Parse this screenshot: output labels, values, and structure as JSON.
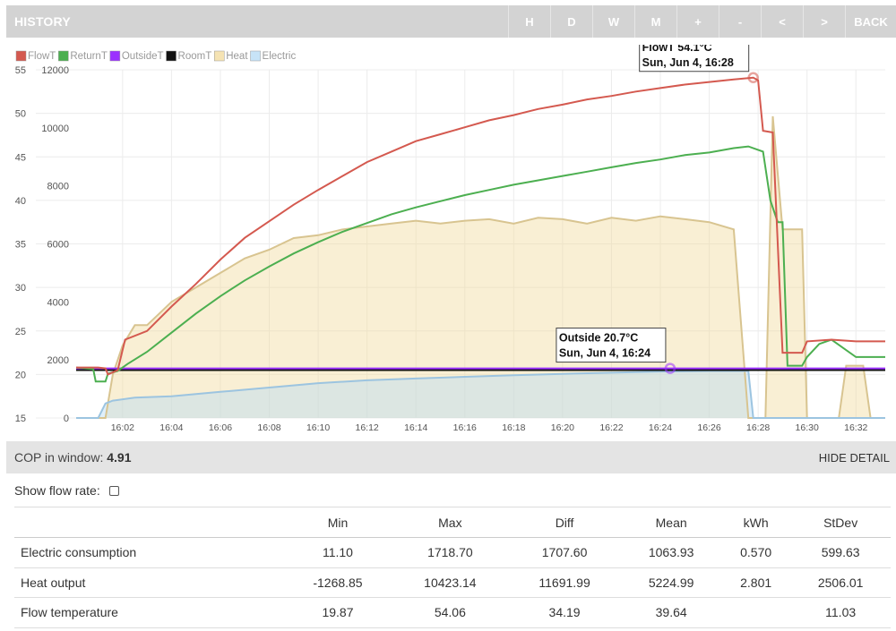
{
  "header": {
    "title": "HISTORY",
    "buttons": [
      "H",
      "D",
      "W",
      "M",
      "+",
      "-",
      "<",
      ">",
      "BACK"
    ]
  },
  "colors": {
    "FlowT": "#d4594f",
    "ReturnT": "#4caf50",
    "OutsideT": "#9b30ff",
    "RoomT": "#111111",
    "Heat": "#f2dca0",
    "Electric": "#b9dcf5"
  },
  "chart_data": {
    "type": "line",
    "legend": [
      "FlowT",
      "ReturnT",
      "OutsideT",
      "RoomT",
      "Heat",
      "Electric"
    ],
    "legend_position": "top-left",
    "y_left": {
      "ticks": [
        "55",
        "50",
        "45",
        "40",
        "35",
        "30",
        "25",
        "20",
        "15"
      ],
      "ylim": [
        15,
        55
      ],
      "unit": "°C"
    },
    "y_right": {
      "ticks": [
        "12000",
        "10000",
        "8000",
        "6000",
        "4000",
        "2000",
        "0"
      ],
      "ylim": [
        0,
        12000
      ],
      "unit": "W"
    },
    "x_ticks": [
      "16:02",
      "16:04",
      "16:06",
      "16:08",
      "16:10",
      "16:12",
      "16:14",
      "16:16",
      "16:18",
      "16:20",
      "16:22",
      "16:24",
      "16:26",
      "16:28",
      "16:30",
      "16:32"
    ],
    "x_range_minutes": [
      0.1,
      33.2
    ],
    "grid": true,
    "series": [
      {
        "name": "FlowT",
        "axis": "left",
        "points": [
          [
            0.1,
            20.8
          ],
          [
            1.0,
            20.8
          ],
          [
            1.3,
            20.7
          ],
          [
            1.4,
            20.0
          ],
          [
            1.8,
            20.5
          ],
          [
            2.1,
            24.0
          ],
          [
            3.0,
            25.0
          ],
          [
            4.0,
            27.8
          ],
          [
            5.0,
            30.4
          ],
          [
            6.0,
            33.2
          ],
          [
            7.0,
            35.7
          ],
          [
            8.0,
            37.6
          ],
          [
            9.0,
            39.5
          ],
          [
            10.0,
            41.2
          ],
          [
            11.0,
            42.8
          ],
          [
            12.0,
            44.4
          ],
          [
            13.0,
            45.6
          ],
          [
            14.0,
            46.8
          ],
          [
            15.0,
            47.6
          ],
          [
            16.0,
            48.4
          ],
          [
            17.0,
            49.2
          ],
          [
            18.0,
            49.8
          ],
          [
            19.0,
            50.5
          ],
          [
            20.0,
            51.0
          ],
          [
            21.0,
            51.6
          ],
          [
            22.0,
            52.0
          ],
          [
            23.0,
            52.5
          ],
          [
            24.0,
            52.9
          ],
          [
            25.0,
            53.3
          ],
          [
            26.0,
            53.6
          ],
          [
            27.0,
            53.9
          ],
          [
            27.8,
            54.1
          ],
          [
            28.0,
            53.8
          ],
          [
            28.2,
            48.0
          ],
          [
            28.6,
            47.8
          ],
          [
            29.0,
            22.5
          ],
          [
            29.8,
            22.5
          ],
          [
            30.0,
            23.8
          ],
          [
            31.0,
            24.0
          ],
          [
            32.0,
            23.8
          ],
          [
            33.2,
            23.8
          ]
        ]
      },
      {
        "name": "ReturnT",
        "axis": "left",
        "points": [
          [
            0.1,
            20.8
          ],
          [
            0.8,
            20.6
          ],
          [
            0.9,
            19.2
          ],
          [
            1.3,
            19.2
          ],
          [
            1.4,
            20.1
          ],
          [
            1.8,
            20.4
          ],
          [
            2.2,
            21.2
          ],
          [
            3.0,
            22.6
          ],
          [
            4.0,
            24.8
          ],
          [
            5.0,
            27.0
          ],
          [
            6.0,
            29.0
          ],
          [
            7.0,
            30.8
          ],
          [
            8.0,
            32.4
          ],
          [
            9.0,
            33.9
          ],
          [
            10.0,
            35.2
          ],
          [
            11.0,
            36.4
          ],
          [
            12.0,
            37.4
          ],
          [
            13.0,
            38.4
          ],
          [
            14.0,
            39.2
          ],
          [
            15.0,
            39.9
          ],
          [
            16.0,
            40.6
          ],
          [
            17.0,
            41.2
          ],
          [
            18.0,
            41.8
          ],
          [
            19.0,
            42.3
          ],
          [
            20.0,
            42.8
          ],
          [
            21.0,
            43.3
          ],
          [
            22.0,
            43.8
          ],
          [
            23.0,
            44.3
          ],
          [
            24.0,
            44.7
          ],
          [
            25.0,
            45.2
          ],
          [
            26.0,
            45.5
          ],
          [
            27.0,
            46.0
          ],
          [
            27.6,
            46.2
          ],
          [
            28.2,
            45.6
          ],
          [
            28.5,
            40.0
          ],
          [
            28.8,
            37.5
          ],
          [
            29.0,
            37.5
          ],
          [
            29.2,
            21.0
          ],
          [
            29.8,
            21.0
          ],
          [
            30.0,
            22.0
          ],
          [
            30.5,
            23.5
          ],
          [
            31.0,
            24.0
          ],
          [
            32.0,
            22.0
          ],
          [
            33.2,
            22.0
          ]
        ]
      },
      {
        "name": "OutsideT",
        "axis": "left",
        "points": [
          [
            0.1,
            20.7
          ],
          [
            33.2,
            20.7
          ]
        ]
      },
      {
        "name": "RoomT",
        "axis": "left",
        "points": [
          [
            0.1,
            20.5
          ],
          [
            33.2,
            20.5
          ]
        ]
      },
      {
        "name": "Heat",
        "axis": "right",
        "points": [
          [
            0.1,
            0
          ],
          [
            1.3,
            0
          ],
          [
            1.6,
            1500
          ],
          [
            2.0,
            2500
          ],
          [
            2.5,
            3200
          ],
          [
            3.0,
            3200
          ],
          [
            3.5,
            3600
          ],
          [
            4.0,
            4000
          ],
          [
            5.0,
            4500
          ],
          [
            6.0,
            5000
          ],
          [
            7.0,
            5500
          ],
          [
            8.0,
            5800
          ],
          [
            9.0,
            6200
          ],
          [
            10.0,
            6300
          ],
          [
            11.0,
            6500
          ],
          [
            12.0,
            6600
          ],
          [
            13.0,
            6700
          ],
          [
            14.0,
            6800
          ],
          [
            15.0,
            6700
          ],
          [
            16.0,
            6800
          ],
          [
            17.0,
            6850
          ],
          [
            18.0,
            6700
          ],
          [
            19.0,
            6900
          ],
          [
            20.0,
            6850
          ],
          [
            21.0,
            6700
          ],
          [
            22.0,
            6900
          ],
          [
            23.0,
            6800
          ],
          [
            24.0,
            6950
          ],
          [
            25.0,
            6850
          ],
          [
            26.0,
            6750
          ],
          [
            27.0,
            6500
          ],
          [
            27.6,
            0
          ],
          [
            28.3,
            0
          ],
          [
            28.6,
            10400
          ],
          [
            29.0,
            6500
          ],
          [
            29.8,
            6500
          ],
          [
            30.0,
            0
          ],
          [
            31.3,
            0
          ],
          [
            31.6,
            1800
          ],
          [
            32.3,
            1800
          ],
          [
            32.6,
            0
          ],
          [
            33.2,
            0
          ]
        ]
      },
      {
        "name": "Electric",
        "axis": "right",
        "points": [
          [
            0.1,
            0
          ],
          [
            1.0,
            0
          ],
          [
            1.3,
            500
          ],
          [
            1.6,
            600
          ],
          [
            2.5,
            700
          ],
          [
            4.0,
            750
          ],
          [
            6.0,
            900
          ],
          [
            8.0,
            1050
          ],
          [
            10.0,
            1200
          ],
          [
            12.0,
            1300
          ],
          [
            14.0,
            1360
          ],
          [
            16.0,
            1420
          ],
          [
            18.0,
            1470
          ],
          [
            20.0,
            1520
          ],
          [
            22.0,
            1560
          ],
          [
            24.0,
            1600
          ],
          [
            26.0,
            1620
          ],
          [
            27.6,
            1620
          ],
          [
            27.8,
            0
          ],
          [
            33.2,
            0
          ]
        ]
      }
    ],
    "tooltips": [
      {
        "line1": "FlowT 54.1°C",
        "line2": "Sun, Jun 4, 16:28",
        "series": "FlowT",
        "x": 27.8,
        "y": 54.1
      },
      {
        "line1": "Outside 20.7°C",
        "line2": "Sun, Jun 4, 16:24",
        "series": "OutsideT",
        "x": 24.4,
        "y": 20.7
      }
    ]
  },
  "cop": {
    "label": "COP in window:",
    "value": "4.91"
  },
  "hide_detail_label": "HIDE DETAIL",
  "flow_rate_label": "Show flow rate:",
  "stats": {
    "columns": [
      "",
      "Min",
      "Max",
      "Diff",
      "Mean",
      "kWh",
      "StDev"
    ],
    "rows": [
      [
        "Electric consumption",
        "11.10",
        "1718.70",
        "1707.60",
        "1063.93",
        "0.570",
        "599.63"
      ],
      [
        "Heat output",
        "-1268.85",
        "10423.14",
        "11691.99",
        "5224.99",
        "2.801",
        "2506.01"
      ],
      [
        "Flow temperature",
        "19.87",
        "54.06",
        "34.19",
        "39.64",
        "",
        "11.03"
      ]
    ]
  }
}
